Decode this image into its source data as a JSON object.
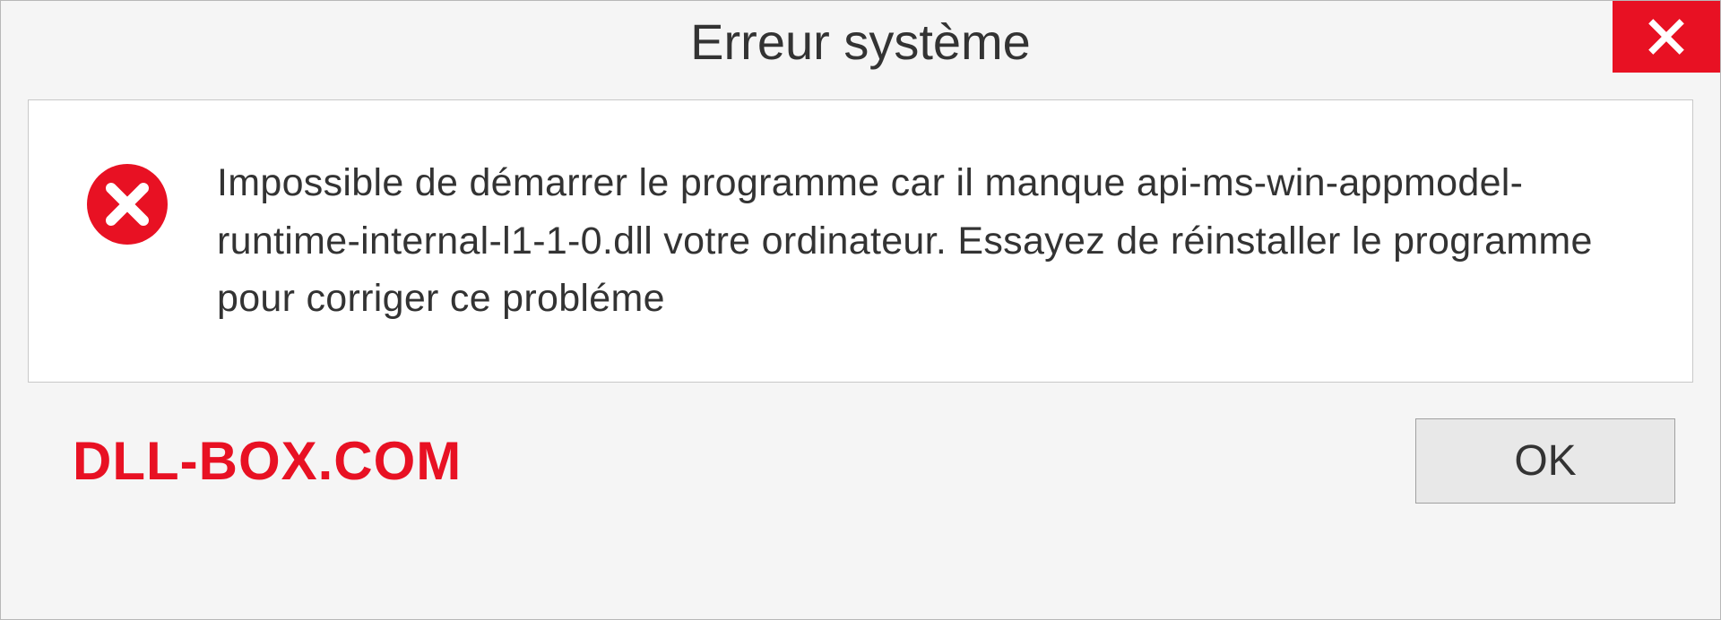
{
  "titlebar": {
    "title": "Erreur système"
  },
  "content": {
    "message": "Impossible de démarrer le programme car il manque api-ms-win-appmodel-runtime-internal-l1-1-0.dll votre ordinateur. Essayez de réinstaller le programme pour corriger ce probléme"
  },
  "footer": {
    "watermark": "DLL-BOX.COM",
    "ok_label": "OK"
  },
  "colors": {
    "accent_red": "#e81123",
    "background": "#f5f5f5",
    "content_bg": "#ffffff"
  }
}
